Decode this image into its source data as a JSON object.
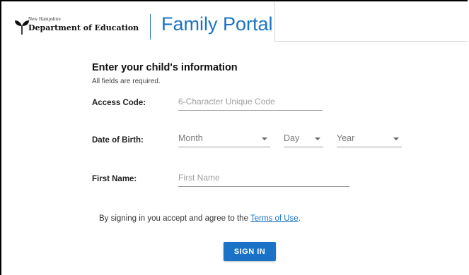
{
  "header": {
    "state_name": "New Hampshire",
    "department_name": "Department of Education",
    "portal_title": "Family Portal",
    "logo_icon": "seedling-icon"
  },
  "form": {
    "heading": "Enter your child's information",
    "subheading": "All fields are required.",
    "access_code": {
      "label": "Access Code:",
      "placeholder": "6-Character Unique Code"
    },
    "date_of_birth": {
      "label": "Date of Birth:",
      "month": "Month",
      "day": "Day",
      "year": "Year"
    },
    "first_name": {
      "label": "First Name:",
      "placeholder": "First Name"
    }
  },
  "terms": {
    "prefix": "By signing in you accept and agree to the ",
    "link_text": "Terms of Use",
    "suffix": "."
  },
  "signin_label": "SIGN IN",
  "colors": {
    "accent": "#1a73c6",
    "text": "#202124",
    "placeholder": "#9e9e9e"
  }
}
